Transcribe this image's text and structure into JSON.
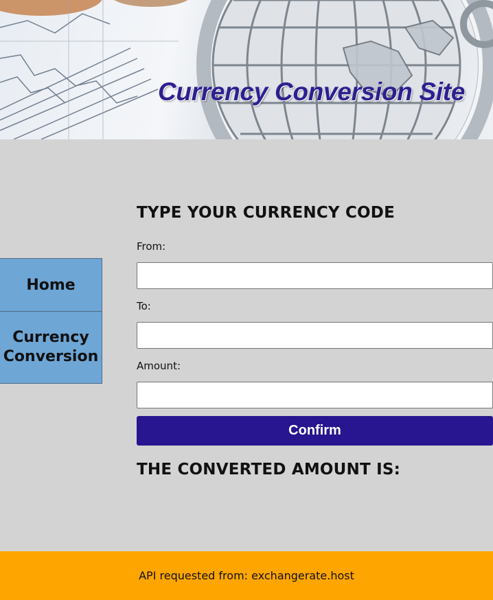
{
  "header": {
    "title": "Currency Conversion Site",
    "banner_image": "globe-keychain-with-coins-and-chart"
  },
  "sidebar": {
    "items": [
      {
        "label": "Home"
      },
      {
        "label": "Currency Conversion"
      }
    ],
    "bg_color": "#6ea6d6"
  },
  "form": {
    "heading": "TYPE YOUR CURRENCY CODE",
    "from_label": "From:",
    "from_value": "",
    "to_label": "To:",
    "to_value": "",
    "amount_label": "Amount:",
    "amount_value": "",
    "confirm_label": "Confirm",
    "confirm_color": "#27168f"
  },
  "result": {
    "label": "THE CONVERTED AMOUNT IS:"
  },
  "footer": {
    "text": "API requested from: exchangerate.host",
    "bg_color": "#ffa500"
  }
}
